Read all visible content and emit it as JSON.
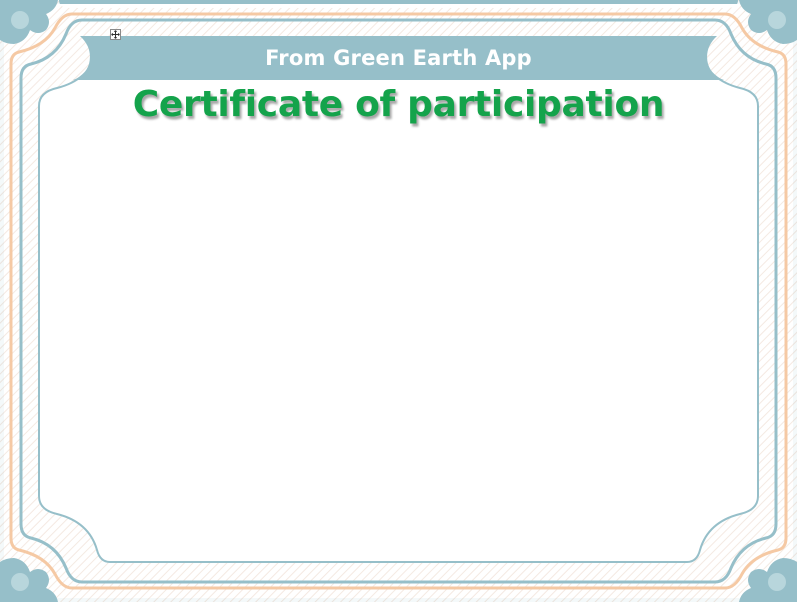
{
  "certificate": {
    "banner_text": "From Green Earth App",
    "title": "Certificate of participation"
  },
  "icons": {
    "table_move_handle": "move-arrows-icon"
  },
  "colors": {
    "frame_blue": "#96bfc9",
    "frame_orange": "#f5c9a4",
    "title_green": "#14a34b",
    "banner_text": "#ffffff"
  }
}
